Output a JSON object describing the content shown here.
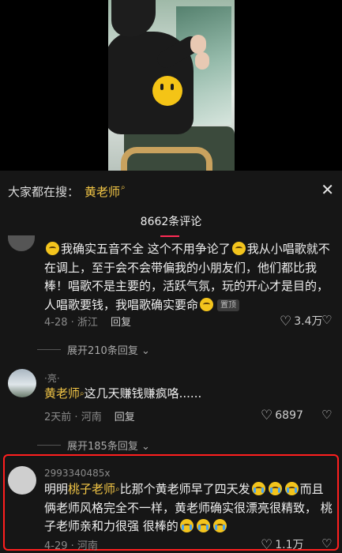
{
  "search": {
    "prefix": "大家都在搜：",
    "term": "黄老师",
    "term_icon": "search-icon"
  },
  "panel": {
    "title": "8662条评论"
  },
  "comments": [
    {
      "text_parts": [
        "我确实五音不全 这个不用争论了",
        "我从小唱歌就不在调上，至于会不会带偏我的小朋友们，他们都比我棒！唱歌不是主要的，活跃气氛，玩的开心才是目的，人唱歌要钱，我唱歌确实要命"
      ],
      "pinned": "置顶",
      "date": "4-28",
      "location": "浙江",
      "reply_label": "回复",
      "likes": "3.4万",
      "expand_label": "展开210条回复"
    },
    {
      "username": "·亮·",
      "link": "黄老师",
      "text": "这几天赚钱赚疯咯......",
      "date": "2天前",
      "location": "河南",
      "reply_label": "回复",
      "likes": "6897",
      "expand_label": "展开185条回复"
    },
    {
      "username": "2993340485x",
      "prefix": "明明",
      "link": "桃子老师",
      "text_a": "比那个黄老师早了四天发",
      "text_b": "而且俩老师风格完全不一样，黄老师确实很漂亮很精致， 桃子老师亲和力很强 很棒的",
      "date": "4-29",
      "location": "河南",
      "likes": "1.1万"
    }
  ],
  "colors": {
    "accent_yellow": "#f3c646",
    "underline_red": "#ff2c55",
    "highlight_red": "#ff1f1f"
  }
}
